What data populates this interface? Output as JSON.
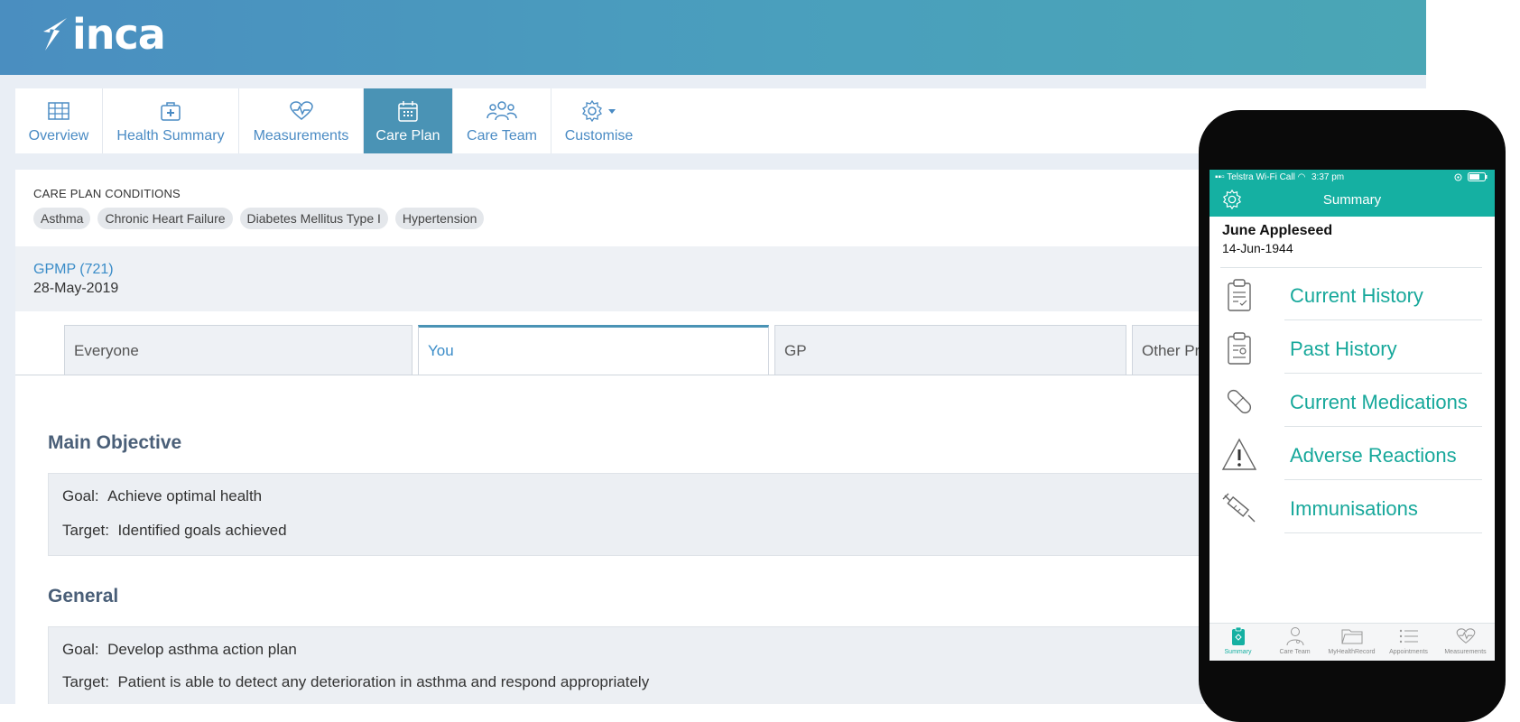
{
  "app": {
    "logo_text": "inca"
  },
  "nav": {
    "tabs": [
      {
        "label": "Overview",
        "icon": "table-icon"
      },
      {
        "label": "Health Summary",
        "icon": "medical-kit-icon"
      },
      {
        "label": "Measurements",
        "icon": "heart-pulse-icon"
      },
      {
        "label": "Care Plan",
        "icon": "calendar-icon",
        "active": true
      },
      {
        "label": "Care Team",
        "icon": "group-icon"
      },
      {
        "label": "Customise",
        "icon": "gear-icon"
      }
    ]
  },
  "conditions": {
    "heading": "CARE PLAN CONDITIONS",
    "chips": [
      "Asthma",
      "Chronic Heart Failure",
      "Diabetes Mellitus Type I",
      "Hypertension"
    ]
  },
  "plan": {
    "link": "GPMP (721)",
    "date": "28-May-2019"
  },
  "plan_tabs": [
    {
      "label": "Everyone"
    },
    {
      "label": "You",
      "active": true
    },
    {
      "label": "GP"
    },
    {
      "label": "Other Pr"
    }
  ],
  "sections": [
    {
      "title": "Main Objective",
      "goal_label": "Goal:",
      "goal": "Achieve optimal health",
      "target_label": "Target:",
      "target": "Identified goals achieved"
    },
    {
      "title": "General",
      "goal_label": "Goal:",
      "goal": "Develop asthma action plan",
      "target_label": "Target:",
      "target": "Patient is able to detect any deterioration in asthma and respond appropriately"
    }
  ],
  "mobile": {
    "status": {
      "carrier": "Telstra Wi-Fi Call",
      "time": "3:37 pm"
    },
    "title": "Summary",
    "patient": {
      "name": "June Appleseed",
      "dob": "14-Jun-1944"
    },
    "items": [
      {
        "label": "Current History",
        "icon": "clipboard-check-icon"
      },
      {
        "label": "Past History",
        "icon": "clipboard-history-icon"
      },
      {
        "label": "Current Medications",
        "icon": "pill-icon"
      },
      {
        "label": "Adverse Reactions",
        "icon": "warning-icon"
      },
      {
        "label": "Immunisations",
        "icon": "syringe-icon"
      }
    ],
    "tabbar": [
      {
        "label": "Summary",
        "active": true
      },
      {
        "label": "Care Team"
      },
      {
        "label": "MyHealthRecord"
      },
      {
        "label": "Appointments"
      },
      {
        "label": "Measurements"
      }
    ],
    "accent": "#15b0a2"
  }
}
